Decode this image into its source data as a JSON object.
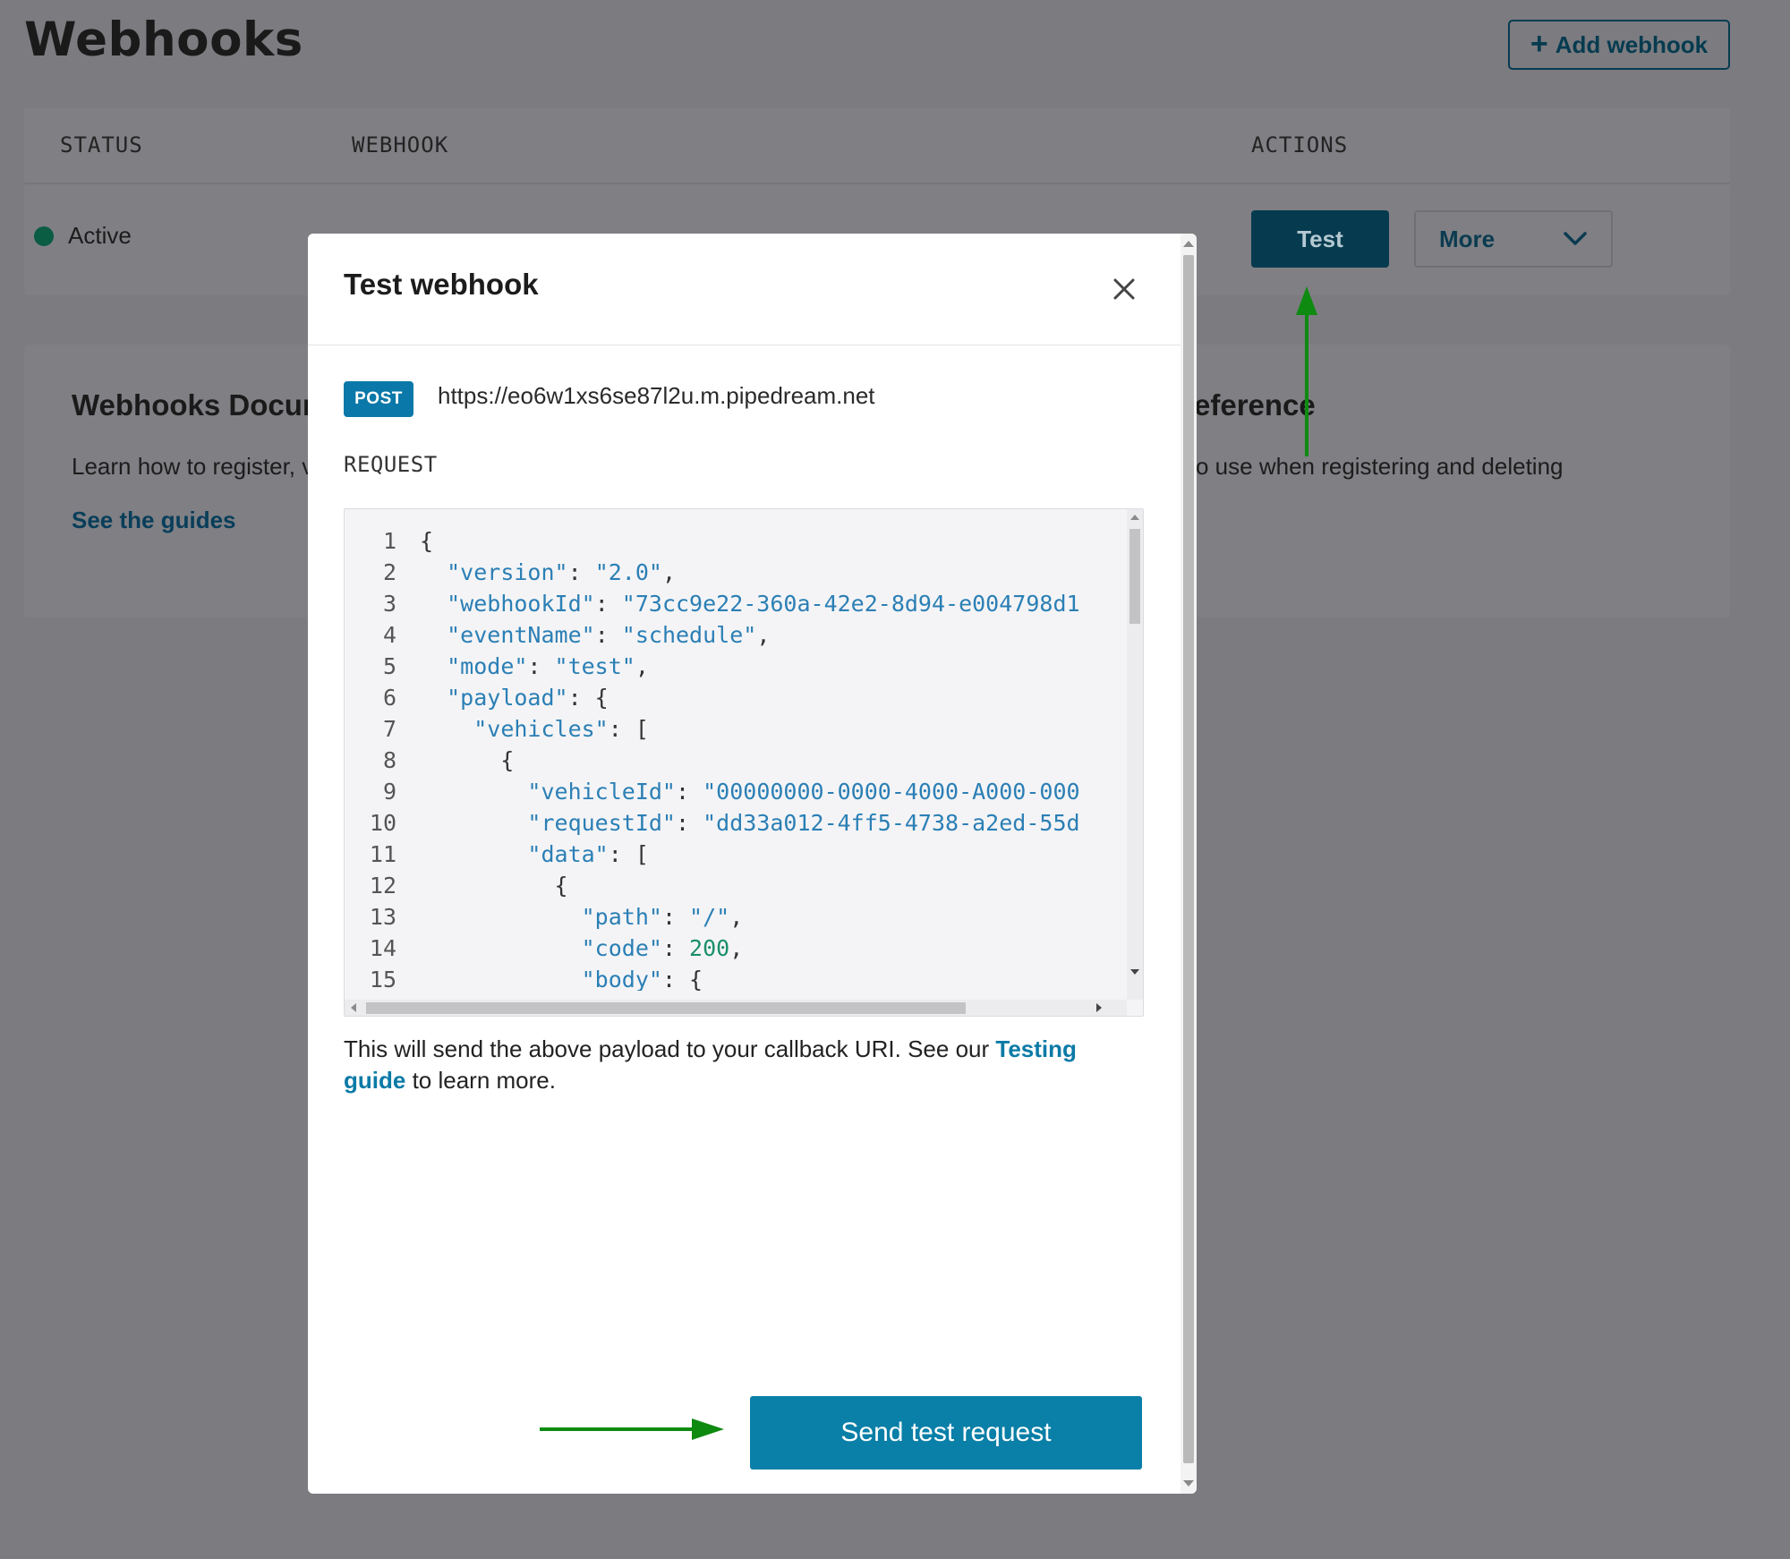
{
  "page": {
    "title": "Webhooks",
    "add_button": "Add webhook"
  },
  "table": {
    "headers": {
      "status": "STATUS",
      "webhook": "WEBHOOK",
      "actions": "ACTIONS"
    },
    "row": {
      "status": "Active",
      "test_label": "Test",
      "more_label": "More"
    }
  },
  "docs": {
    "left_title": "Webhooks Docum",
    "left_text": "Learn how to register, v",
    "left_link": "See the guides",
    "right_title": "eference",
    "right_text": "o use when registering and deleting"
  },
  "modal": {
    "title": "Test webhook",
    "method": "POST",
    "url": "https://eo6w1xs6se87l2u.m.pipedream.net",
    "request_label": "REQUEST",
    "help_before": "This will send the above payload to your callback URI. See our ",
    "help_link": "Testing guide",
    "help_after": " to learn more.",
    "send_button": "Send test request"
  },
  "code": [
    "{",
    "  \"version\": \"2.0\",",
    "  \"webhookId\": \"73cc9e22-360a-42e2-8d94-e004798d1",
    "  \"eventName\": \"schedule\",",
    "  \"mode\": \"test\",",
    "  \"payload\": {",
    "    \"vehicles\": [",
    "      {",
    "        \"vehicleId\": \"00000000-0000-4000-A000-000",
    "        \"requestId\": \"dd33a012-4ff5-4738-a2ed-55d",
    "        \"data\": [",
    "          {",
    "            \"path\": \"/\",",
    "            \"code\": 200,",
    "            \"body\": {"
  ],
  "colors": {
    "accent": "#0a7fa7",
    "annotation_arrow": "#0e8a10",
    "status_active": "#0a5c43"
  }
}
